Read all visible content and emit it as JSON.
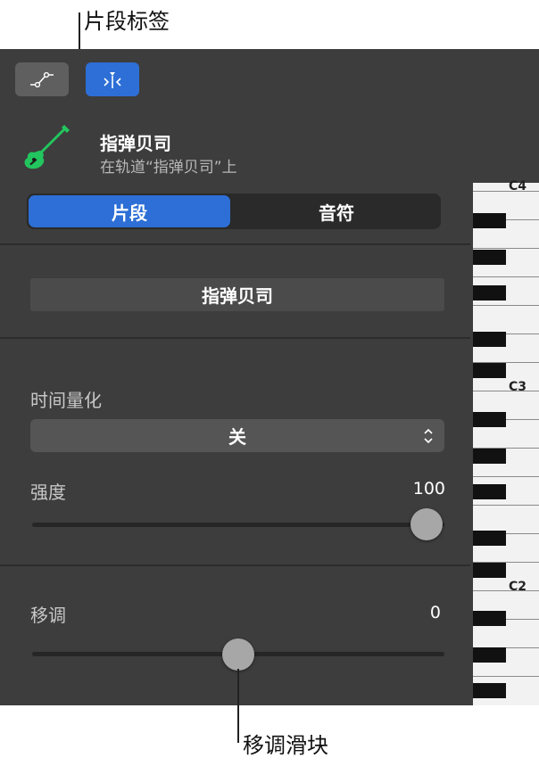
{
  "callouts": {
    "top": "片段标签",
    "bottom": "移调滑块"
  },
  "toolbar": {
    "automation_button": "automation-curve-icon",
    "region_button": "region-inspector-icon"
  },
  "track": {
    "icon": "bass-guitar-icon",
    "name": "指弹贝司",
    "subtitle": "在轨道“指弹贝司”上"
  },
  "tabs": [
    {
      "label": "片段",
      "selected": true
    },
    {
      "label": "音符",
      "selected": false
    }
  ],
  "region_name": "指弹贝司",
  "quantize": {
    "label": "时间量化",
    "value": "关"
  },
  "velocity": {
    "label": "强度",
    "value": "100",
    "level": 1.0
  },
  "transpose": {
    "label": "移调",
    "value": "0",
    "level": 0.5
  },
  "keyboard": {
    "labels": [
      "C4",
      "C3",
      "C2"
    ]
  },
  "colors": {
    "accent": "#2d6fd6",
    "panel": "#3d3d3d",
    "track_icon": "#22c55e"
  }
}
